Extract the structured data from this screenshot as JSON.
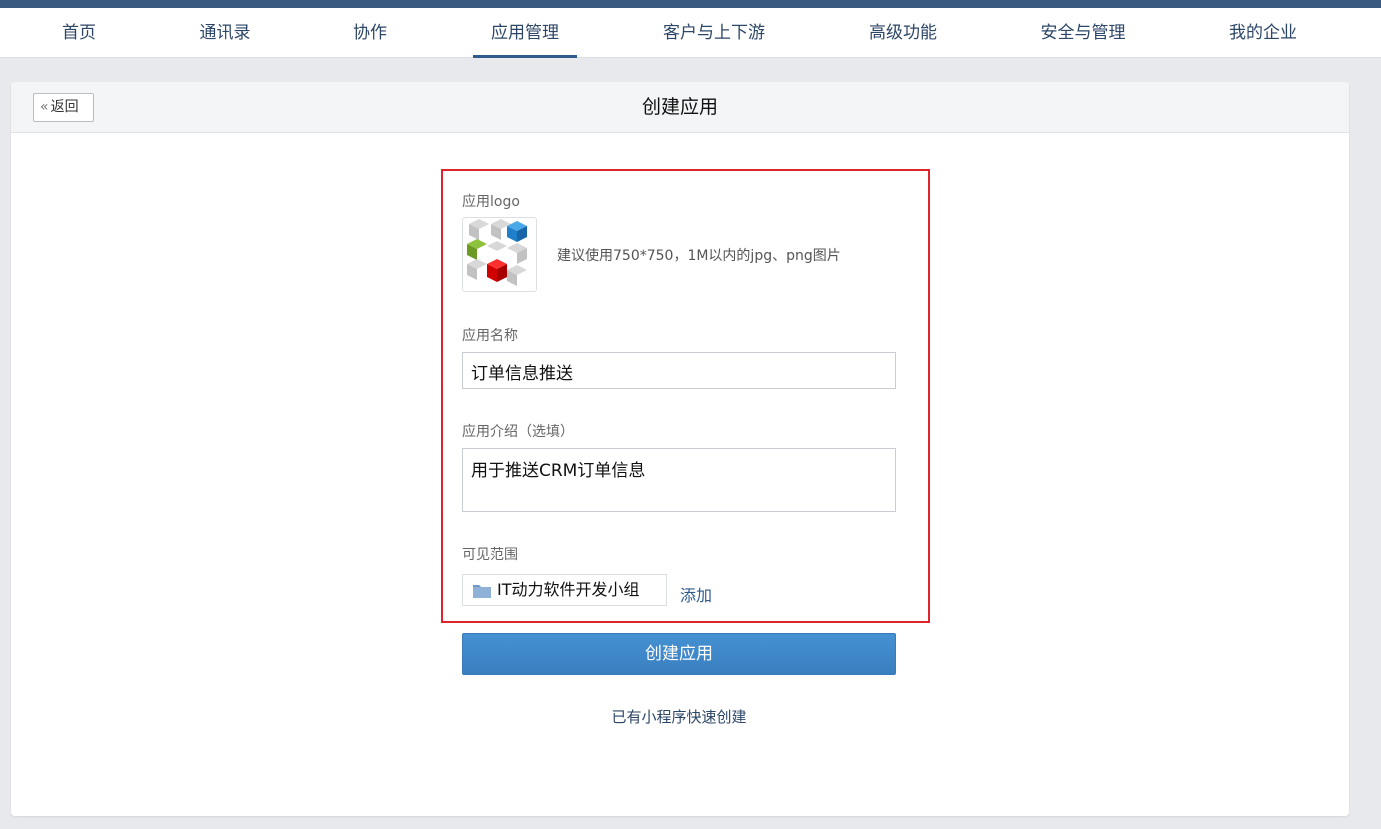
{
  "nav": {
    "items": [
      {
        "label": "首页"
      },
      {
        "label": "通讯录"
      },
      {
        "label": "协作"
      },
      {
        "label": "应用管理",
        "active": true
      },
      {
        "label": "客户与上下游"
      },
      {
        "label": "高级功能"
      },
      {
        "label": "安全与管理"
      },
      {
        "label": "我的企业"
      }
    ]
  },
  "header": {
    "back_label": "返回",
    "title": "创建应用"
  },
  "form": {
    "logo_label": "应用logo",
    "logo_hint": "建议使用750*750，1M以内的jpg、png图片",
    "name_label": "应用名称",
    "name_value": "订单信息推送",
    "intro_label": "应用介绍（选填）",
    "intro_value": "用于推送CRM订单信息",
    "scope_label": "可见范围",
    "scope_item": "IT动力软件开发小组",
    "add_label": "添加",
    "submit_label": "创建应用",
    "quick_create_label": "已有小程序快速创建"
  },
  "colors": {
    "accent": "#3a7fc0",
    "nav_text": "#2c4668",
    "highlight_border": "#e0242b"
  }
}
